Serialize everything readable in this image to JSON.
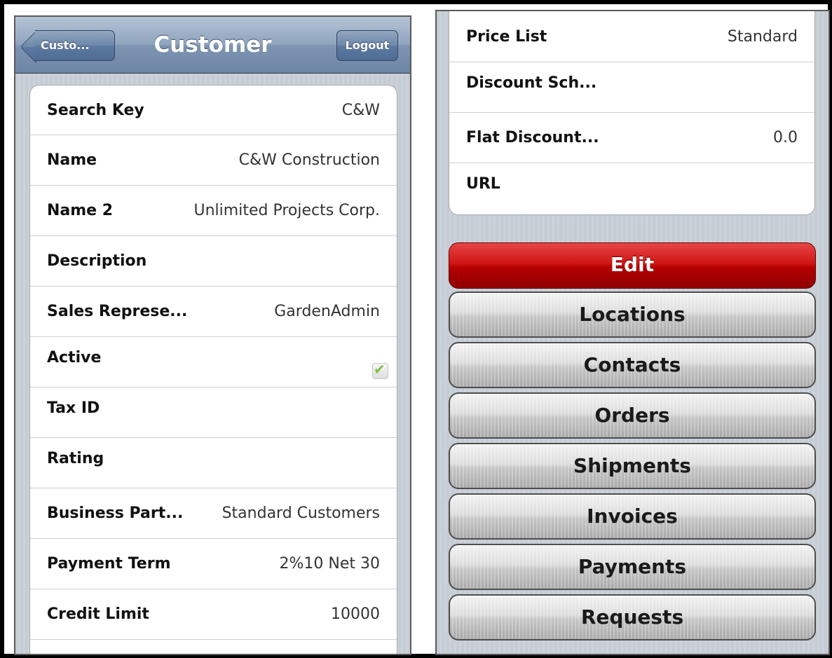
{
  "nav": {
    "title": "Customer",
    "back_label": "Custo...",
    "logout_label": "Logout"
  },
  "fields_left": [
    {
      "label": "Search Key",
      "value": "C&W"
    },
    {
      "label": "Name",
      "value": "C&W Construction"
    },
    {
      "label": "Name 2",
      "value": "Unlimited Projects Corp."
    },
    {
      "label": "Description",
      "value": ""
    },
    {
      "label": "Sales Represe...",
      "value": "GardenAdmin"
    },
    {
      "label": "Active",
      "value": "",
      "checked": true
    },
    {
      "label": "Tax ID",
      "value": ""
    },
    {
      "label": "Rating",
      "value": ""
    },
    {
      "label": "Business Part...",
      "value": "Standard Customers"
    },
    {
      "label": "Payment Term",
      "value": "2%10 Net 30"
    },
    {
      "label": "Credit Limit",
      "value": "10000"
    }
  ],
  "fields_right": [
    {
      "label": "Price List",
      "value": "Standard"
    },
    {
      "label": "Discount Sch...",
      "value": ""
    },
    {
      "label": "Flat Discount...",
      "value": "0.0"
    },
    {
      "label": "URL",
      "value": ""
    }
  ],
  "actions": {
    "edit": "Edit",
    "locations": "Locations",
    "contacts": "Contacts",
    "orders": "Orders",
    "shipments": "Shipments",
    "invoices": "Invoices",
    "payments": "Payments",
    "requests": "Requests"
  },
  "colors": {
    "nav_bar": "#7e95b2",
    "edit_button": "#cf1515",
    "checkbox_check": "#7cc242"
  }
}
